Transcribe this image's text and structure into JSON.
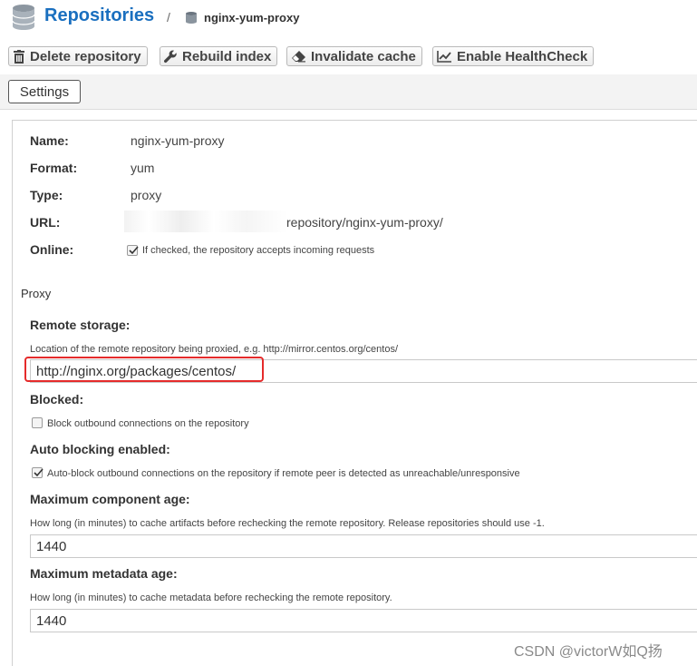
{
  "header": {
    "title": "Repositories",
    "separator": "/",
    "repo_name": "nginx-yum-proxy",
    "title_color": "#1a6fbf",
    "icons": [
      "database-icon",
      "repository-icon"
    ]
  },
  "toolbar": {
    "buttons": [
      {
        "label": "Delete repository",
        "icon": "trash-icon"
      },
      {
        "label": "Rebuild index",
        "icon": "wrench-icon"
      },
      {
        "label": "Invalidate cache",
        "icon": "eraser-icon"
      },
      {
        "label": "Enable HealthCheck",
        "icon": "chart-line-icon"
      }
    ]
  },
  "settings_tab": {
    "label": "Settings"
  },
  "summary": {
    "name_label": "Name:",
    "name_value": "nginx-yum-proxy",
    "format_label": "Format:",
    "format_value": "yum",
    "type_label": "Type:",
    "type_value": "proxy",
    "url_label": "URL:",
    "url_value": "repository/nginx-yum-proxy/",
    "online_label": "Online:",
    "online_text": "If checked, the repository accepts incoming requests",
    "online_checked": true
  },
  "proxy": {
    "section_title": "Proxy",
    "remote_storage": {
      "label": "Remote storage:",
      "help": "Location of the remote repository being proxied, e.g. http://mirror.centos.org/centos/",
      "value": "http://nginx.org/packages/centos/",
      "highlight_color": "#e52b2b"
    },
    "blocked": {
      "label": "Blocked:",
      "text": "Block outbound connections on the repository",
      "checked": false
    },
    "auto_blocking": {
      "label": "Auto blocking enabled:",
      "text": "Auto-block outbound connections on the repository if remote peer is detected as unreachable/unresponsive",
      "checked": true
    },
    "max_component_age": {
      "label": "Maximum component age:",
      "help": "How long (in minutes) to cache artifacts before rechecking the remote repository. Release repositories should use -1.",
      "value": "1440"
    },
    "max_metadata_age": {
      "label": "Maximum metadata age:",
      "help": "How long (in minutes) to cache metadata before rechecking the remote repository.",
      "value": "1440"
    }
  },
  "watermark": "CSDN @victorW如Q扬"
}
